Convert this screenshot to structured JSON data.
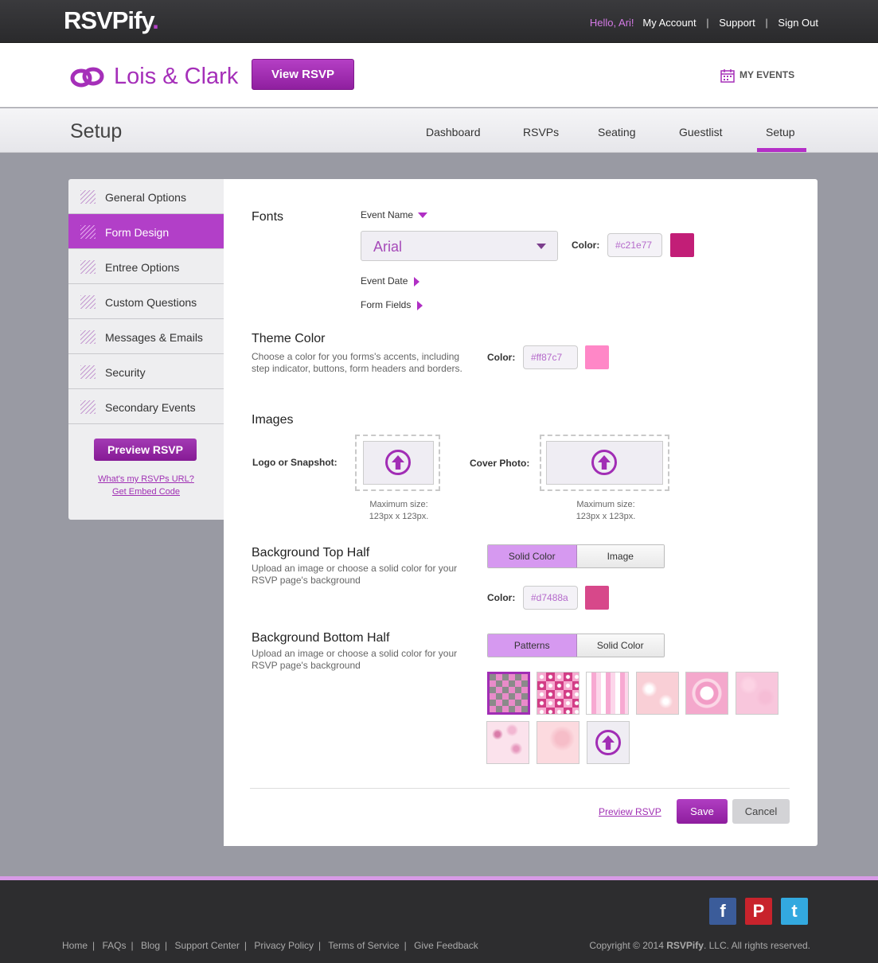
{
  "app": {
    "logo": "RSVPify",
    "logo_dot": "."
  },
  "user_links": {
    "hello": "Hello, Ari!",
    "account": "My Account",
    "support": "Support",
    "signout": "Sign Out",
    "sep": "|"
  },
  "header": {
    "event_title": "Lois & Clark",
    "view_rsvp": "View RSVP",
    "my_events": "MY EVENTS"
  },
  "nav": {
    "page_title": "Setup",
    "tabs": [
      {
        "label": "Dashboard"
      },
      {
        "label": "RSVPs"
      },
      {
        "label": "Seating"
      },
      {
        "label": "Guestlist"
      },
      {
        "label": "Setup"
      }
    ],
    "active": "Setup"
  },
  "sidebar": {
    "items": [
      {
        "label": "General Options"
      },
      {
        "label": "Form Design"
      },
      {
        "label": "Entree Options"
      },
      {
        "label": "Custom Questions"
      },
      {
        "label": "Messages & Emails"
      },
      {
        "label": "Security"
      },
      {
        "label": "Secondary Events"
      }
    ],
    "active": "Form Design",
    "preview": "Preview RSVP",
    "url_link": "What's my RSVPs URL?",
    "embed_link": "Get Embed Code"
  },
  "fonts": {
    "title": "Fonts",
    "event_name": "Event Name",
    "font_value": "Arial",
    "color_label": "Color:",
    "color_value": "#c21e77",
    "color_hex": "#c21e77",
    "event_date": "Event Date",
    "form_fields": "Form Fields"
  },
  "theme": {
    "title": "Theme Color",
    "desc": "Choose a color for you forms's accents, including step indicator, buttons, form headers and borders.",
    "color_label": "Color:",
    "color_value": "#ff87c7",
    "color_hex": "#ff87c7"
  },
  "images": {
    "title": "Images",
    "logo_label": "Logo or Snapshot:",
    "cover_label": "Cover Photo:",
    "max_line1": "Maximum size:",
    "max_line2": "123px x 123px."
  },
  "bg_top": {
    "title": "Background Top Half",
    "desc": "Upload an image or choose a solid color for your RSVP page's background",
    "opt_solid": "Solid Color",
    "opt_image": "Image",
    "selected": "Solid Color",
    "color_label": "Color:",
    "color_value": "#d7488a",
    "color_hex": "#d7488a"
  },
  "bg_bottom": {
    "title": "Background Bottom Half",
    "desc": "Upload an image or choose a solid color for your RSVP page's background",
    "opt_patterns": "Patterns",
    "opt_solid": "Solid Color",
    "selected": "Patterns"
  },
  "actions": {
    "preview": "Preview RSVP",
    "save": "Save",
    "cancel": "Cancel"
  },
  "footer": {
    "links": [
      "Home",
      "FAQs",
      "Blog",
      "Support Center",
      "Privacy Policy",
      "Terms of Service",
      "Give Feedback"
    ],
    "sep": "|",
    "copyright_pre": "Copyright © 2014 ",
    "copyright_brand": "RSVPify",
    "copyright_post": ". LLC. All rights reserved.",
    "social": [
      "facebook-icon",
      "pinterest-icon",
      "twitter-icon"
    ]
  }
}
